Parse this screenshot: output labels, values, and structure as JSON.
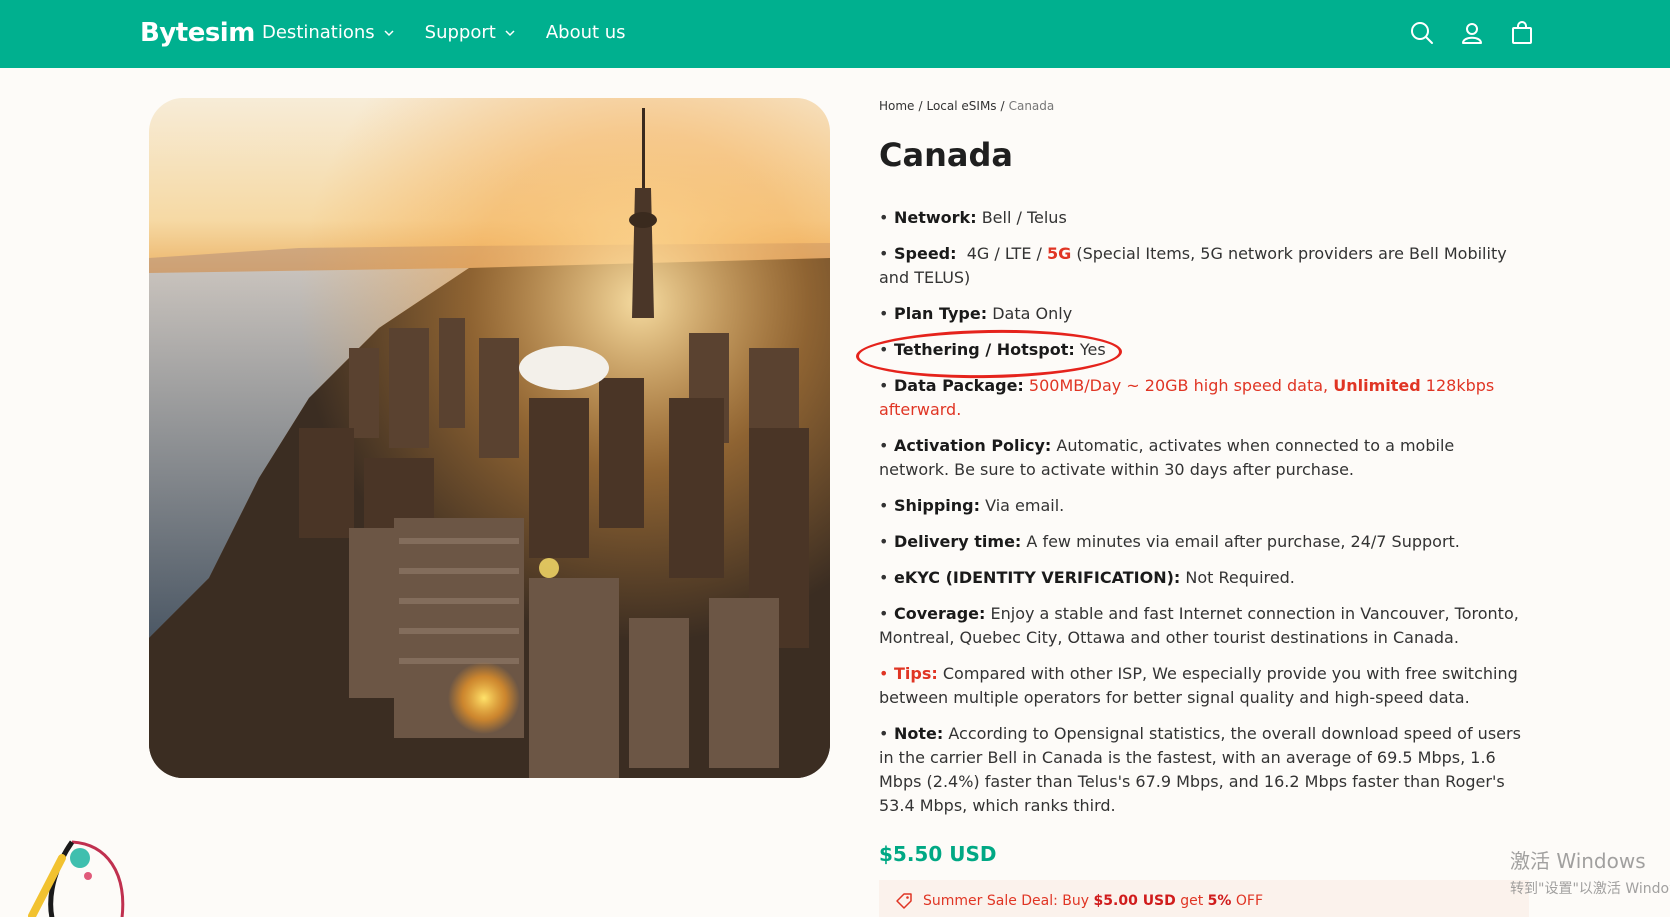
{
  "header": {
    "logo": "Bytesim",
    "nav": [
      {
        "label": "Destinations",
        "has_dropdown": true
      },
      {
        "label": "Support",
        "has_dropdown": true
      },
      {
        "label": "About us",
        "has_dropdown": false
      }
    ],
    "icons": [
      "search-icon",
      "account-icon",
      "cart-icon"
    ],
    "bg_color": "#00b08f"
  },
  "breadcrumb": {
    "home": "Home",
    "sep": "/",
    "local": "Local eSIMs",
    "current": "Canada"
  },
  "product": {
    "title": "Canada",
    "image_alt": "Toronto skyline with CN Tower at sunset",
    "specs": {
      "network_label": "Network:",
      "network_value": "Bell / Telus",
      "speed_label": "Speed:",
      "speed_pre": "4G / LTE /",
      "speed_5g": "5G",
      "speed_post": "(Special Items, 5G network providers are Bell Mobility and TELUS)",
      "plan_label": "Plan Type:",
      "plan_value": "Data Only",
      "tether_label": "Tethering / Hotspot:",
      "tether_value": "Yes",
      "data_label": "Data Package:",
      "data_value_1": "500MB/Day ~ 20GB high speed data,",
      "data_unlimited": "Unlimited",
      "data_value_2": "128kbps afterward.",
      "activation_label": "Activation Policy:",
      "activation_value": "Automatic, activates when connected to a mobile network. Be sure to activate within 30 days after purchase.",
      "shipping_label": "Shipping:",
      "shipping_value": "Via email.",
      "delivery_label": "Delivery time:",
      "delivery_value": "A few minutes via email after purchase, 24/7 Support.",
      "ekyc_label": "eKYC (IDENTITY VERIFICATION):",
      "ekyc_value": "Not Required.",
      "coverage_label": "Coverage:",
      "coverage_value": "Enjoy a stable and fast Internet connection in Vancouver, Toronto, Montreal, Quebec City, Ottawa and other tourist destinations in Canada.",
      "tips_label": "Tips:",
      "tips_value": "Compared with other ISP, We especially provide you with free switching between multiple operators for better signal quality and high-speed data.",
      "note_label": "Note:",
      "note_value": "According to Opensignal statistics, the overall download speed of users in the carrier Bell in Canada is the fastest, with an average of 69.5 Mbps, 1.6 Mbps (2.4%) faster than Telus's 67.9 Mbps, and 16.2 Mbps faster than Roger's 53.4 Mbps, which ranks third."
    },
    "price": "$5.50 USD",
    "deal": {
      "pre": "Summer Sale Deal: Buy",
      "amount": "$5.00 USD",
      "mid": "get",
      "pct": "5%",
      "post": "OFF"
    }
  },
  "annotation": {
    "highlight_color": "#e5231c"
  },
  "watermark": {
    "line1": "激活 Windows",
    "line2": "转到\"设置\"以激活 Windows。"
  }
}
